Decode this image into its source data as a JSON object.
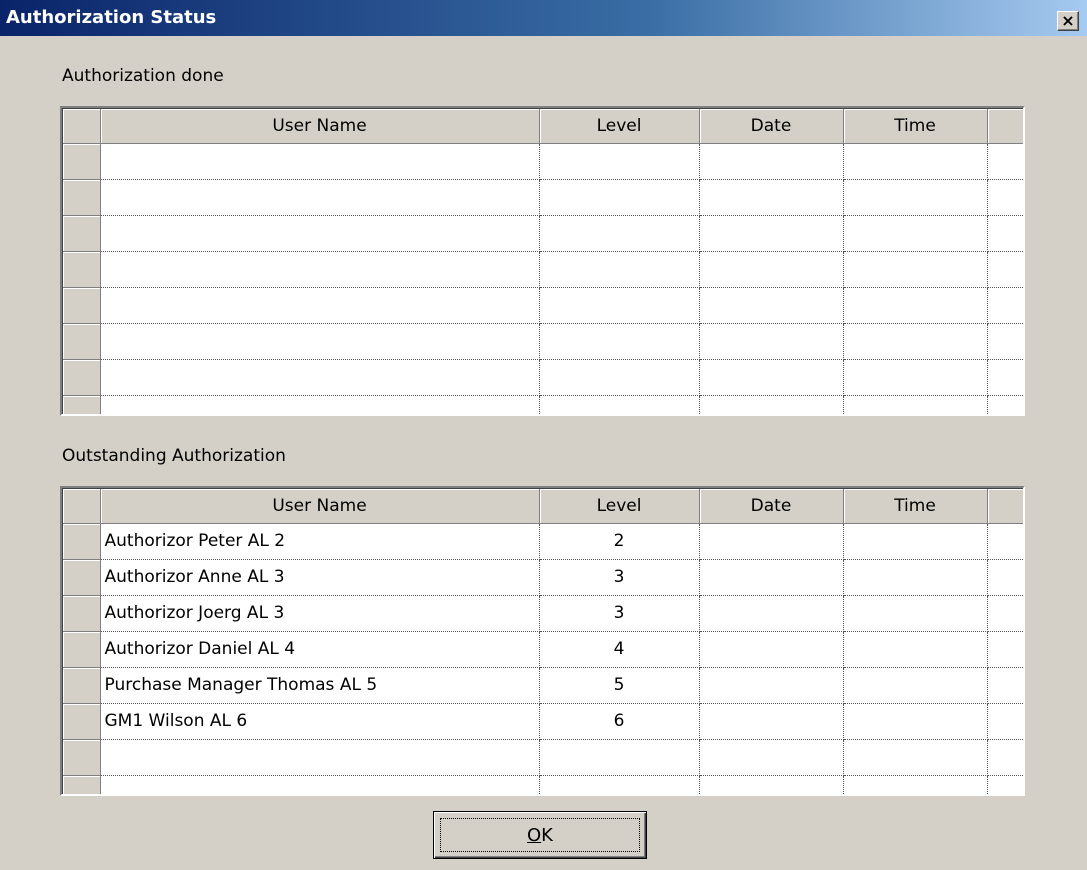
{
  "window": {
    "title": "Authorization Status",
    "close_label": "×"
  },
  "done_section": {
    "label": "Authorization done",
    "columns": [
      "User Name",
      "Level",
      "Date",
      "Time"
    ],
    "rows": [
      [
        "",
        "",
        "",
        ""
      ],
      [
        "",
        "",
        "",
        ""
      ],
      [
        "",
        "",
        "",
        ""
      ],
      [
        "",
        "",
        "",
        ""
      ],
      [
        "",
        "",
        "",
        ""
      ],
      [
        "",
        "",
        "",
        ""
      ],
      [
        "",
        "",
        "",
        ""
      ],
      [
        "",
        "",
        "",
        ""
      ]
    ]
  },
  "outstanding_section": {
    "label": "Outstanding Authorization",
    "columns": [
      "User Name",
      "Level",
      "Date",
      "Time"
    ],
    "rows": [
      [
        "Authorizor Peter AL 2",
        "2",
        "",
        ""
      ],
      [
        "Authorizor Anne AL 3",
        "3",
        "",
        ""
      ],
      [
        "Authorizor Joerg  AL 3",
        "3",
        "",
        ""
      ],
      [
        "Authorizor Daniel AL 4",
        "4",
        "",
        ""
      ],
      [
        "Purchase Manager Thomas AL 5",
        "5",
        "",
        ""
      ],
      [
        "GM1 Wilson AL 6",
        "6",
        "",
        ""
      ],
      [
        "",
        "",
        "",
        ""
      ],
      [
        "",
        "",
        "",
        ""
      ]
    ]
  },
  "ok_button": {
    "mnemonic": "O",
    "rest": "K"
  }
}
